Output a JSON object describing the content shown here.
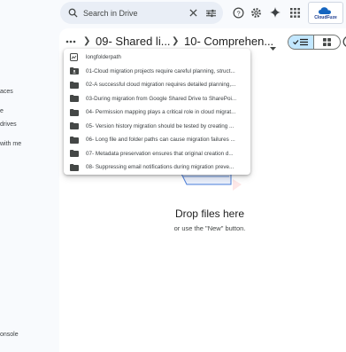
{
  "sidebar": {
    "items": [
      {
        "label": "aces"
      },
      {
        "label": "e"
      },
      {
        "label": "drives"
      },
      {
        "label": "with me"
      },
      {
        "label": "onsole"
      }
    ]
  },
  "search": {
    "placeholder": "Search in Drive"
  },
  "toolbar": {
    "icons": [
      "help-icon",
      "settings-icon",
      "gemini-icon",
      "apps-grid-icon"
    ],
    "logo_text": "CloudFuze"
  },
  "breadcrumb": {
    "items": [
      {
        "label": "09- Shared li..."
      },
      {
        "label": "10- Comprehen..."
      }
    ]
  },
  "dropdown": {
    "items": [
      {
        "label": "longfolderpath",
        "icon": "drive-icon"
      },
      {
        "label": "01-Cloud migration projects require careful planning, struct...",
        "icon": "shared-folder-icon"
      },
      {
        "label": "02-A successful cloud migration requires detailed planning,...",
        "icon": "folder-icon"
      },
      {
        "label": "03-During migration from Google Shared Drive to SharePoi...",
        "icon": "folder-icon"
      },
      {
        "label": "04- Permission mapping plays a critical role in cloud migrat...",
        "icon": "folder-icon"
      },
      {
        "label": "05- Version history migration should be tested by creating ...",
        "icon": "folder-icon"
      },
      {
        "label": "06- Long file and folder paths can cause migration failures ...",
        "icon": "folder-icon"
      },
      {
        "label": "07- Metadata preservation ensures that original creation d...",
        "icon": "folder-icon"
      },
      {
        "label": "08- Suppressing email notifications during migration preve...",
        "icon": "folder-icon"
      }
    ]
  },
  "empty_state": {
    "title": "Drop files here",
    "subtitle": "or use the \"New\" button."
  },
  "colors": {
    "accent": "#c2e7ff",
    "search_bg": "#e9eef6",
    "page_bg": "#f8fafd"
  }
}
